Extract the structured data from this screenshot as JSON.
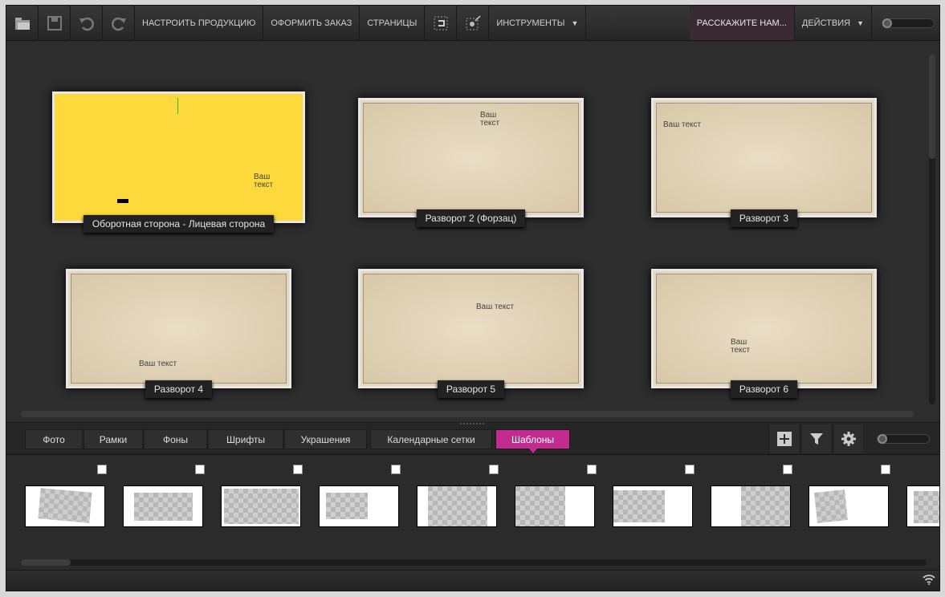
{
  "toolbar": {
    "customize": "НАСТРОИТЬ ПРОДУКЦИЮ",
    "order": "ОФОРМИТЬ ЗАКАЗ",
    "pages": "СТРАНИЦЫ",
    "tools": "ИНСТРУМЕНТЫ",
    "tell": "РАССКАЖИТЕ НАМ...",
    "actions": "ДЕЙСТВИЯ",
    "dropdown_glyph": "▼"
  },
  "spreads": [
    {
      "caption": "Оборотная сторона - Лицевая сторона",
      "text": "Ваш текст",
      "style": "yellow"
    },
    {
      "caption": "Разворот 2 (Форзац)",
      "text": "Ваш текст"
    },
    {
      "caption": "Разворот 3",
      "text": "Ваш текст"
    },
    {
      "caption": "Разворот 4",
      "text": "Ваш текст"
    },
    {
      "caption": "Разворот 5",
      "text": "Ваш текст"
    },
    {
      "caption": "Разворот 6",
      "text": "Ваш текст"
    }
  ],
  "tabs": [
    "Фото",
    "Рамки",
    "Фоны",
    "Шрифты",
    "Украшения",
    "Календарные сетки",
    "Шаблоны"
  ],
  "active_tab": "Шаблоны",
  "colors": {
    "accent": "#c22b8f",
    "cover": "#fdd93b",
    "page": "#e5d7bd"
  }
}
